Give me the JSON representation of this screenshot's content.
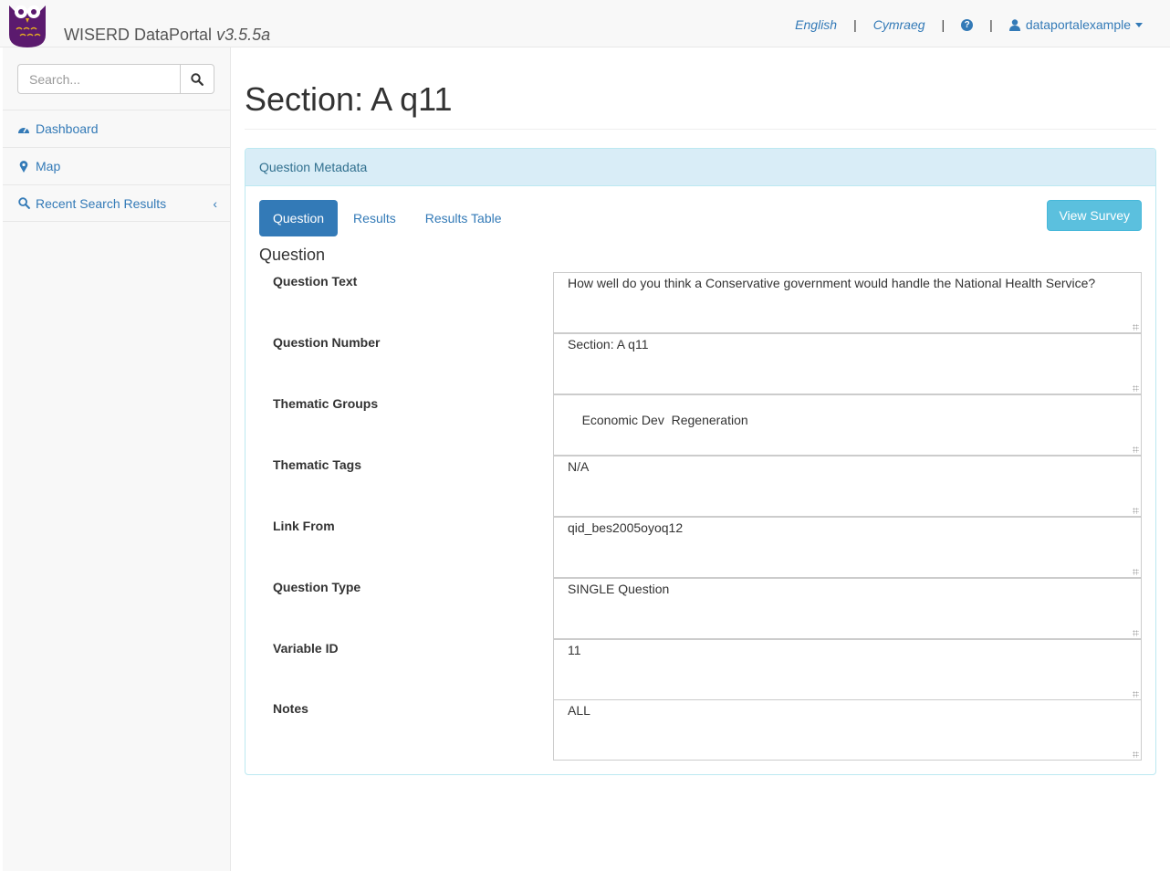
{
  "brand": {
    "name": "WISERD DataPortal",
    "version": "v3.5.5a"
  },
  "nav": {
    "lang_en": "English",
    "lang_cy": "Cymraeg",
    "separator": "|",
    "help_icon": "question-circle-icon",
    "user": "dataportalexample"
  },
  "sidebar": {
    "search_placeholder": "Search...",
    "items": [
      {
        "label": "Dashboard",
        "icon": "dashboard-icon"
      },
      {
        "label": "Map",
        "icon": "map-marker-icon"
      },
      {
        "label": "Recent Search Results",
        "icon": "search-icon",
        "chevron": "‹"
      }
    ]
  },
  "page": {
    "title": "Section: A q11"
  },
  "panel": {
    "heading": "Question Metadata",
    "tabs": [
      "Question",
      "Results",
      "Results Table"
    ],
    "active_tab": "Question",
    "view_survey": "View Survey",
    "section_heading": "Question",
    "fields": [
      {
        "label": "Question Text",
        "value": "How well do you think a Conservative government would handle the National Health Service?"
      },
      {
        "label": "Question Number",
        "value": "Section: A q11"
      },
      {
        "label": "Thematic Groups",
        "value": "Economic Dev  Regeneration"
      },
      {
        "label": "Thematic Tags",
        "value": "N/A"
      },
      {
        "label": "Link From",
        "value": "qid_bes2005oyoq12"
      },
      {
        "label": "Question Type",
        "value": "SINGLE Question"
      },
      {
        "label": "Variable ID",
        "value": "11"
      },
      {
        "label": "Notes",
        "value": "ALL"
      }
    ]
  },
  "colors": {
    "link": "#337ab7",
    "panel_heading_bg": "#d9edf7",
    "info_button": "#5bc0de",
    "logo_purple": "#5b1a6e"
  }
}
